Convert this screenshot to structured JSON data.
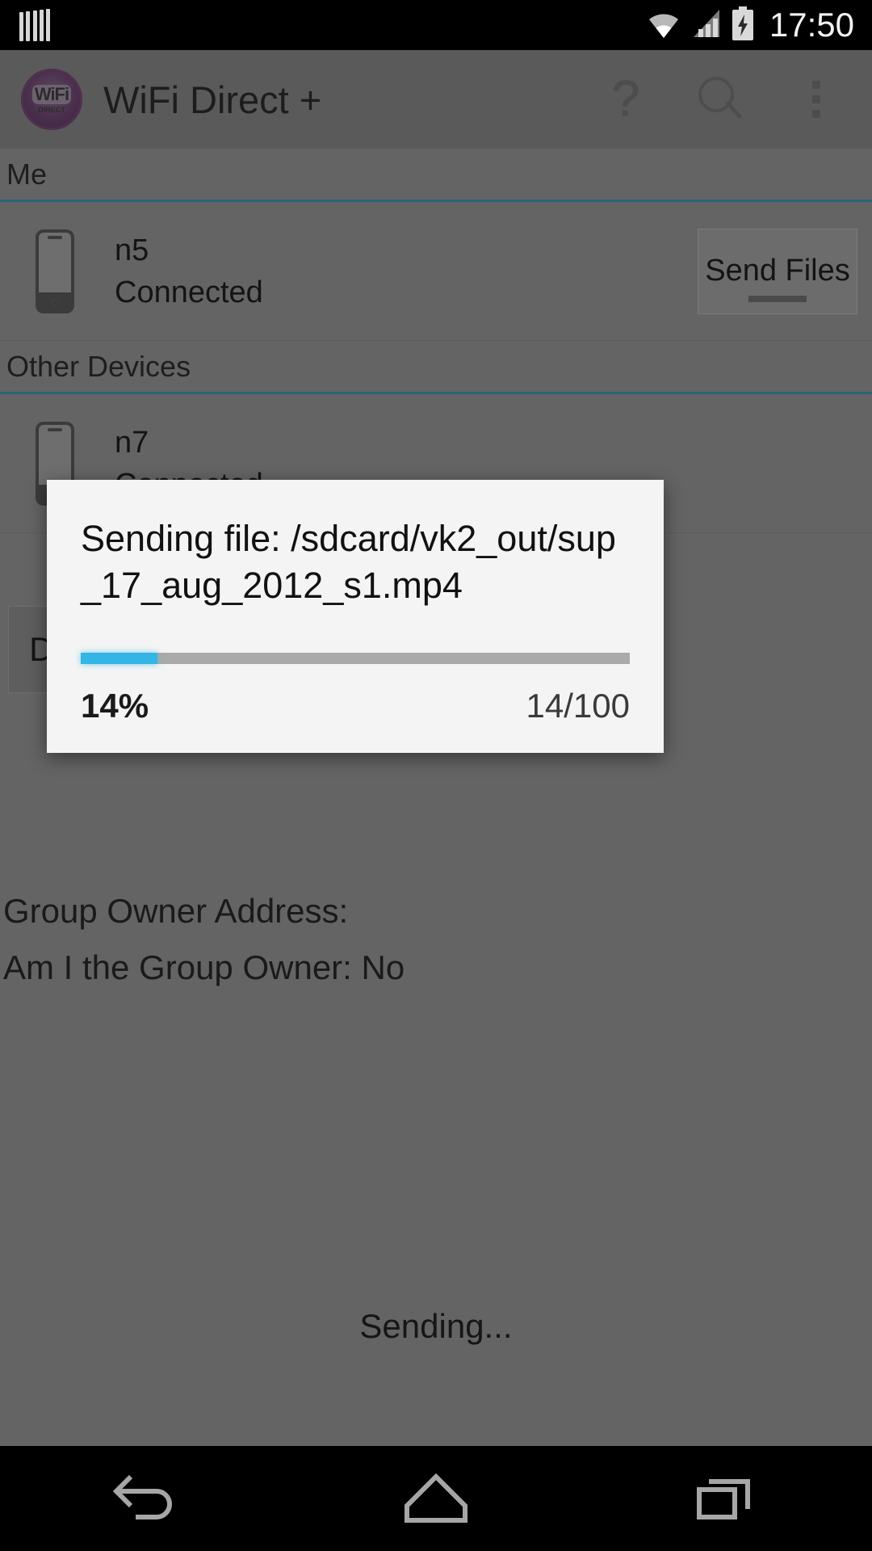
{
  "status_bar": {
    "notification_icon": "app-bars-icon",
    "wifi_icon": "wifi-signal-icon",
    "cell_icon": "cellular-signal-icon",
    "battery_icon": "battery-charging-icon",
    "clock": "17:50"
  },
  "action_bar": {
    "app_icon_name": "wifi-direct-app-icon",
    "app_icon_primary": "WiFi",
    "app_icon_secondary": "DIRECT",
    "title": "WiFi Direct +",
    "actions": [
      {
        "name": "help-icon",
        "glyph": "?"
      },
      {
        "name": "search-icon",
        "glyph": "search"
      },
      {
        "name": "overflow-menu-icon",
        "glyph": "more-vertical"
      }
    ]
  },
  "sections": [
    {
      "header": "Me",
      "devices": [
        {
          "name": "n5",
          "status": "Connected",
          "button": "Send Files"
        }
      ]
    },
    {
      "header": "Other Devices",
      "devices": [
        {
          "name": "n7",
          "status": "Connected"
        }
      ]
    }
  ],
  "background_content": {
    "disconnect_button": "Disconnect",
    "group_info_line1": "Group Owner Address:",
    "group_info_line2": "Am I the Group Owner: No",
    "sending_label": "Sending..."
  },
  "dialog": {
    "name": "file-transfer-progress-dialog",
    "message": "Sending file: /sdcard/vk2_out/sup_17_aug_2012_s1.mp4",
    "progress_percent_label": "14%",
    "progress_count_label": "14/100",
    "progress_value": 14,
    "progress_max": 100,
    "fill_color": "#33b5e5",
    "track_color": "#aaaaaa",
    "background_color": "#f4f4f4"
  },
  "nav_bar": {
    "back": "back-button",
    "home": "home-button",
    "recents": "recents-button"
  },
  "theme": {
    "status_bar_bg": "#000000",
    "action_bar_bg": "#5a5a5a",
    "app_bg_dimmed": "#646464",
    "divider_accent": "#2c6478",
    "accent_blue": "#33b5e5"
  }
}
